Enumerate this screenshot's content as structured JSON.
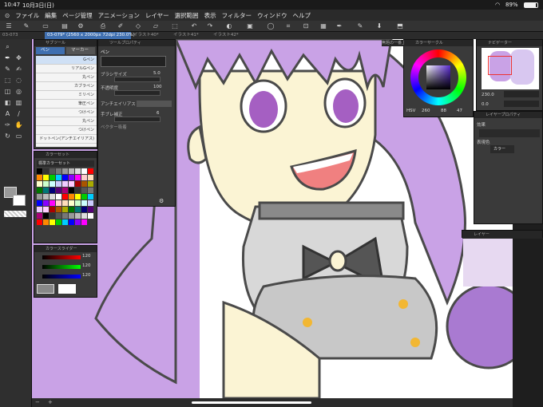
{
  "status": {
    "time": "10:47",
    "date": "10月3日(日)",
    "battery": "89%"
  },
  "menu": [
    "ファイル",
    "編集",
    "ページ管理",
    "アニメーション",
    "レイヤー",
    "選択範囲",
    "表示",
    "フィルター",
    "ウィンドウ",
    "ヘルプ"
  ],
  "tabs": [
    {
      "label": "03-073"
    },
    {
      "label": "03-079* (2560 x 2000px 72dpi 230.0%)"
    },
    {
      "label": "イラスト40*"
    },
    {
      "label": "イラスト41*"
    },
    {
      "label": "イラスト42*"
    }
  ],
  "subtool": {
    "title": "サブツール",
    "tab1": "ペン",
    "tab2": "マーカー",
    "brushes": [
      "Gペン",
      "リアルGペン",
      "丸ペン",
      "カブラペン",
      "ミリペン",
      "筆圧ペン",
      "つけペン",
      "丸ペン",
      "つけペン",
      "ドットペン(アンチエイリアス)"
    ]
  },
  "toolprop": {
    "title": "ツールプロパティ",
    "name": "ペン",
    "size_label": "ブラシサイズ",
    "size_value": "5.0",
    "opacity_label": "不透明度",
    "opacity_value": "100",
    "aa_label": "アンチエイリアス",
    "stab_label": "手ブレ補正",
    "stab_value": "6",
    "vector_label": "ベクター吸着"
  },
  "colorset": {
    "title": "カラーセット",
    "name": "標準カラーセット"
  },
  "colorslider": {
    "title": "カラースライダー",
    "r": "120",
    "g": "120",
    "b": "120"
  },
  "colorcircle": {
    "title": "カラーサークル",
    "mode_label": "HSV",
    "v1": "260",
    "v2": "88",
    "v3": "47",
    "tab_left": "無題の一番上の素材"
  },
  "navigator": {
    "title": "ナビゲーター",
    "zoom": "230.0",
    "angle": "0.0"
  },
  "layerprop": {
    "title": "レイヤープロパティ",
    "effect_label": "効果",
    "display_label": "表現色",
    "display_value": "カラー"
  },
  "layer": {
    "title": "レイヤー"
  },
  "colors": {
    "hair": "#c9a2e6",
    "skin": "#fbf4d4",
    "outline": "#4a4a4a",
    "accent": "#3f6fb0"
  }
}
